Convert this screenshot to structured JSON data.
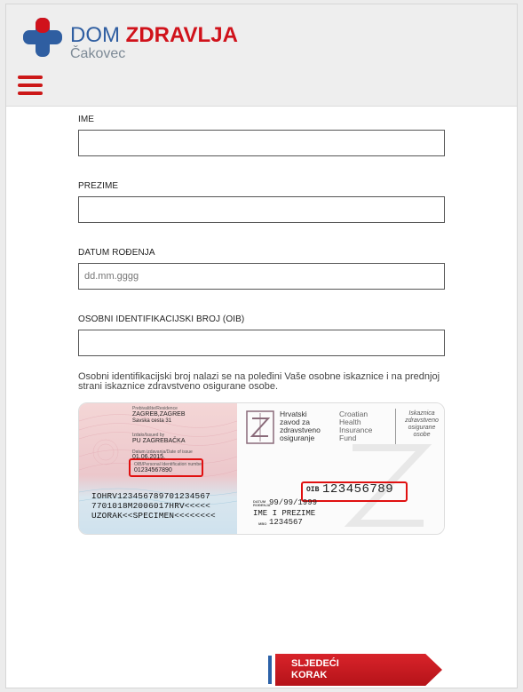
{
  "header": {
    "brand_part1": "DOM ",
    "brand_part2": "ZDRAVLJA",
    "city": "Čakovec",
    "menu_icon": "hamburger-menu-icon",
    "colors": {
      "brand_blue": "#2f5ea1",
      "brand_red": "#d0121b",
      "menu_red": "#cc1818"
    }
  },
  "form": {
    "ime_label": "IME",
    "ime_value": "",
    "prezime_label": "PREZIME",
    "prezime_value": "",
    "datum_label": "DATUM ROĐENJA",
    "datum_placeholder": "dd.mm.gggg",
    "oib_label": "OSOBNI IDENTIFIKACIJSKI BROJ (OIB)",
    "oib_value": "",
    "help_text": "Osobni identifikacijski broj nalazi se na poleđini Vaše osobne iskaznice i na prednjoj strani iskaznice zdravstveno osigurane osobe."
  },
  "card": {
    "left": {
      "small1": "Prebivalište/Residence",
      "addr1": "ZAGREB,ZAGREB",
      "addr2": "Savska cesta 31",
      "small2": "Izdalo/Issued by",
      "issuer": "PU ZAGREBAČKA",
      "small3": "Datum izdavanja/Date of issue",
      "issue_date": "01.06.2015.",
      "small4": "OIB/Personal Identification number",
      "oib": "01234567890",
      "mrz1": "IOHRV123456789701234567",
      "mrz2": "7701018M2006017HRV<<<<<",
      "mrz3": "UZORAK<<SPECIMEN<<<<<<<<"
    },
    "right": {
      "hr_line1": "Hrvatski",
      "hr_line2": "zavod za",
      "hr_line3": "zdravstveno",
      "hr_line4": "osiguranje",
      "en_line1": "Croatian",
      "en_line2": "Health",
      "en_line3": "Insurance",
      "en_line4": "Fund",
      "it_line1": "Iskaznica",
      "it_line2": "zdravstveno",
      "it_line3": "osigurane",
      "it_line4": "osobe",
      "oib_prefix": "OIB",
      "oib_number": "123456789",
      "date_prefix": "DATUM\nROĐENJA",
      "date": "99/99/1999",
      "name": "IME I PREZIME",
      "mbo_prefix": "MBO",
      "mbo": "1234567"
    }
  },
  "actions": {
    "next_line1": "SLJEDEĆI",
    "next_line2": "KORAK"
  }
}
